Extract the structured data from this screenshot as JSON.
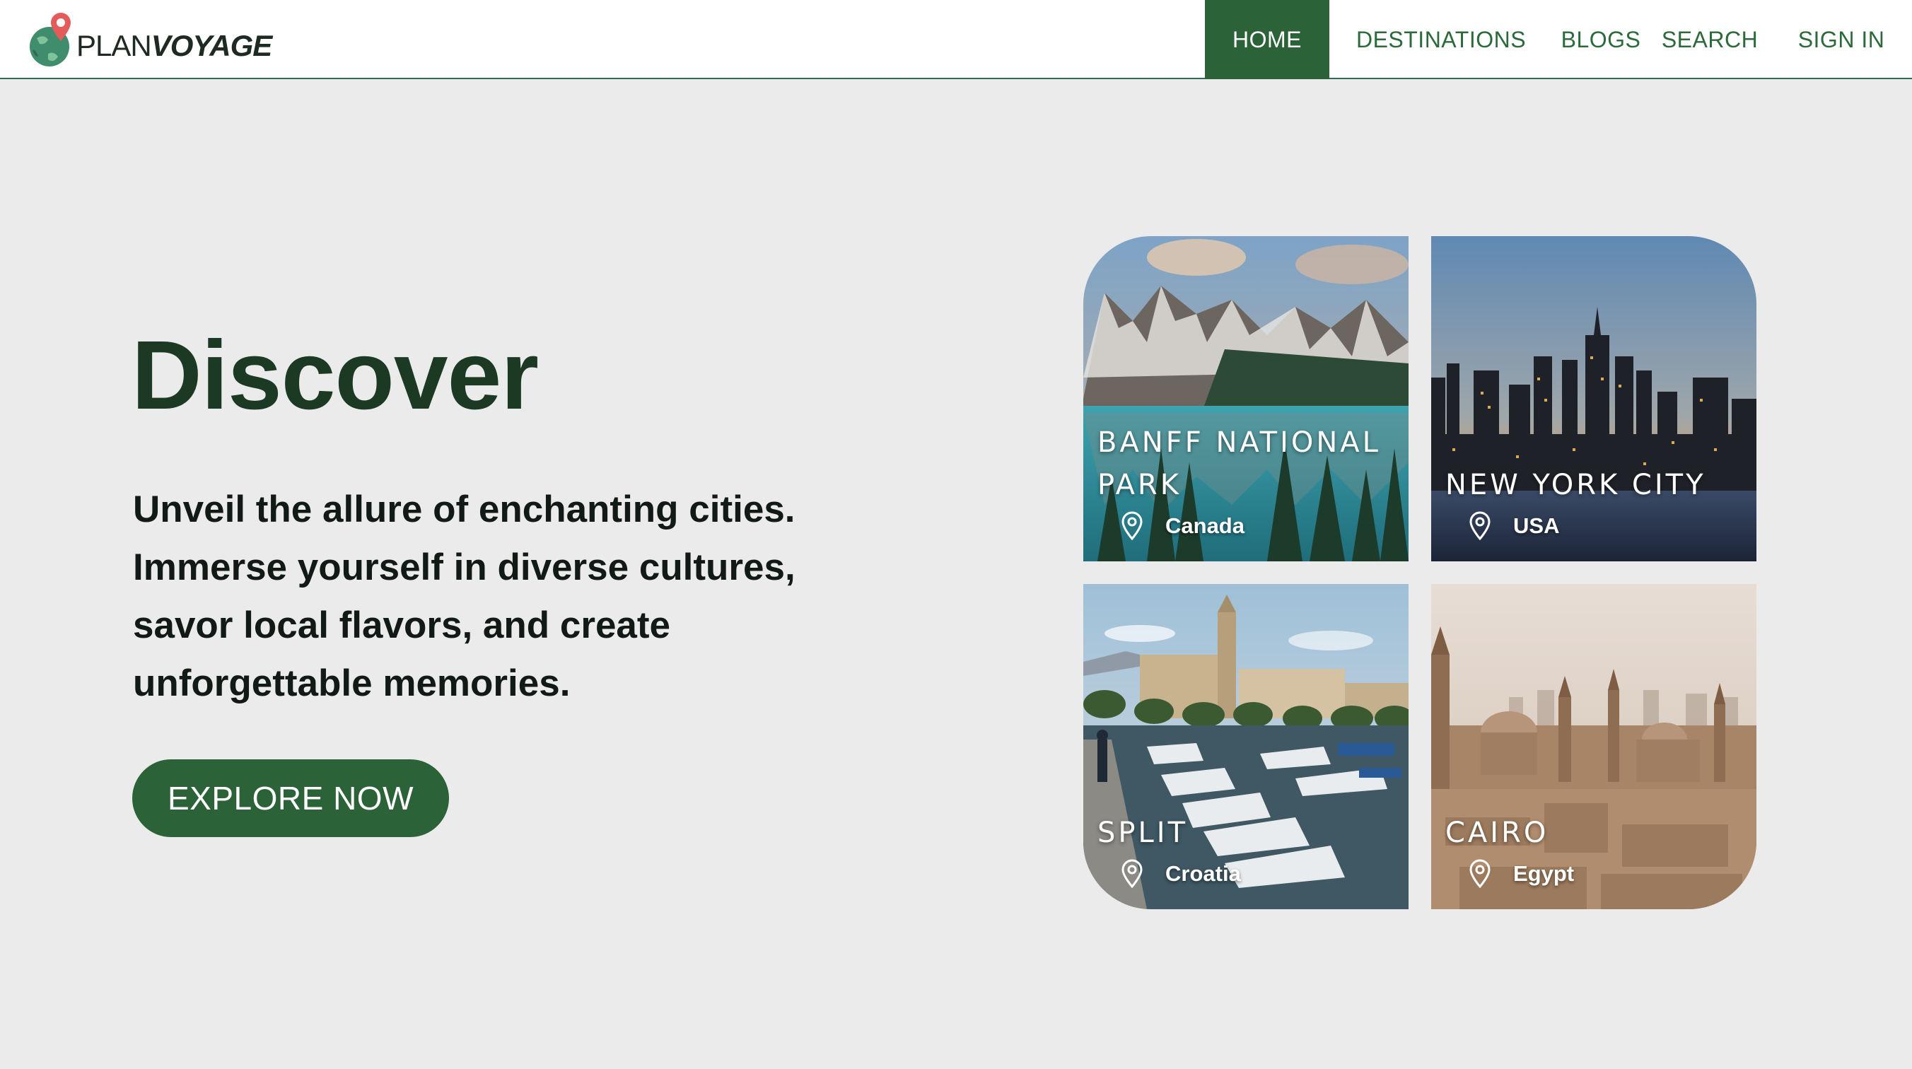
{
  "brand": {
    "name_part1": "PLAN",
    "name_part2": "VOYAGE",
    "logo_icon": "globe-pin-icon"
  },
  "nav": {
    "items": [
      {
        "label": "HOME",
        "active": true
      },
      {
        "label": "DESTINATIONS",
        "active": false
      },
      {
        "label": "BLOGS",
        "active": false
      },
      {
        "label": "SEARCH",
        "active": false
      },
      {
        "label": "SIGN IN",
        "active": false
      }
    ]
  },
  "hero": {
    "title": "Discover",
    "subtitle": "Unveil the allure of enchanting cities. Immerse yourself in diverse cultures, savor local flavors, and create unforgettable memories.",
    "cta_label": "EXPLORE NOW"
  },
  "destinations": [
    {
      "name": "BANFF NATIONAL PARK",
      "country": "Canada",
      "icon": "location-pin-icon"
    },
    {
      "name": "NEW YORK CITY",
      "country": "USA",
      "icon": "location-pin-icon"
    },
    {
      "name": "SPLIT",
      "country": "Croatia",
      "icon": "location-pin-icon"
    },
    {
      "name": "CAIRO",
      "country": "Egypt",
      "icon": "location-pin-icon"
    }
  ],
  "colors": {
    "primary_green": "#2b6237",
    "title_green": "#1c3a23",
    "page_background": "#ebebeb",
    "nav_text": "#2d6a3b"
  }
}
